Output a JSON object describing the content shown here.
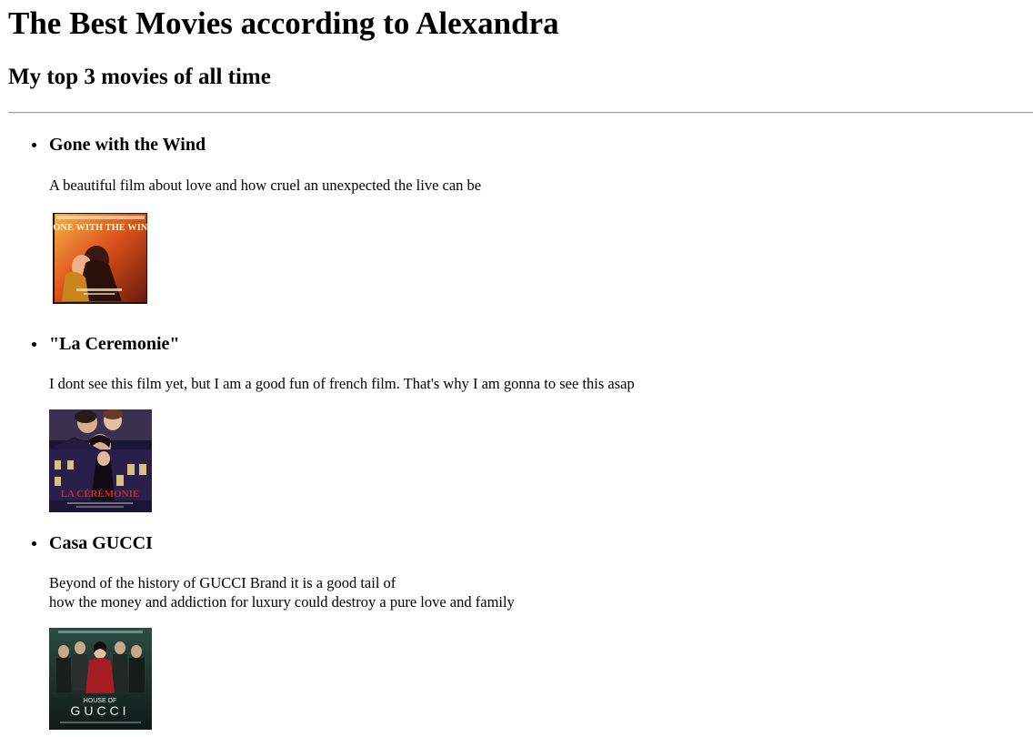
{
  "page": {
    "title": "The Best Movies according to Alexandra",
    "subtitle": "My top 3 movies of all time"
  },
  "movies": [
    {
      "title": "Gone with the Wind",
      "description": "A beautiful film about love and how cruel an unexpected the live can be",
      "poster_text": "GONE WITH THE WIND",
      "poster_colors": [
        "#d9481a",
        "#f2a23c",
        "#3a1a10"
      ]
    },
    {
      "title": "\"La Ceremonie\"",
      "description": "I dont see this film yet, but I am a good fun of french film. That's why I am gonna to see this asap",
      "poster_text": "LA CÉRÉMONIE",
      "poster_colors": [
        "#2a1f4a",
        "#d8c080",
        "#b8251f"
      ]
    },
    {
      "title": "Casa GUCCI",
      "description_lines": [
        "Beyond of the history of GUCCI Brand it is a good tail of",
        "how the money and addiction for luxury could destroy a pure love and family"
      ],
      "poster_text_top": "HOUSE OF",
      "poster_text": "GUCCI",
      "poster_colors": [
        "#1e3b33",
        "#a51c22",
        "#0f1a17"
      ]
    }
  ]
}
